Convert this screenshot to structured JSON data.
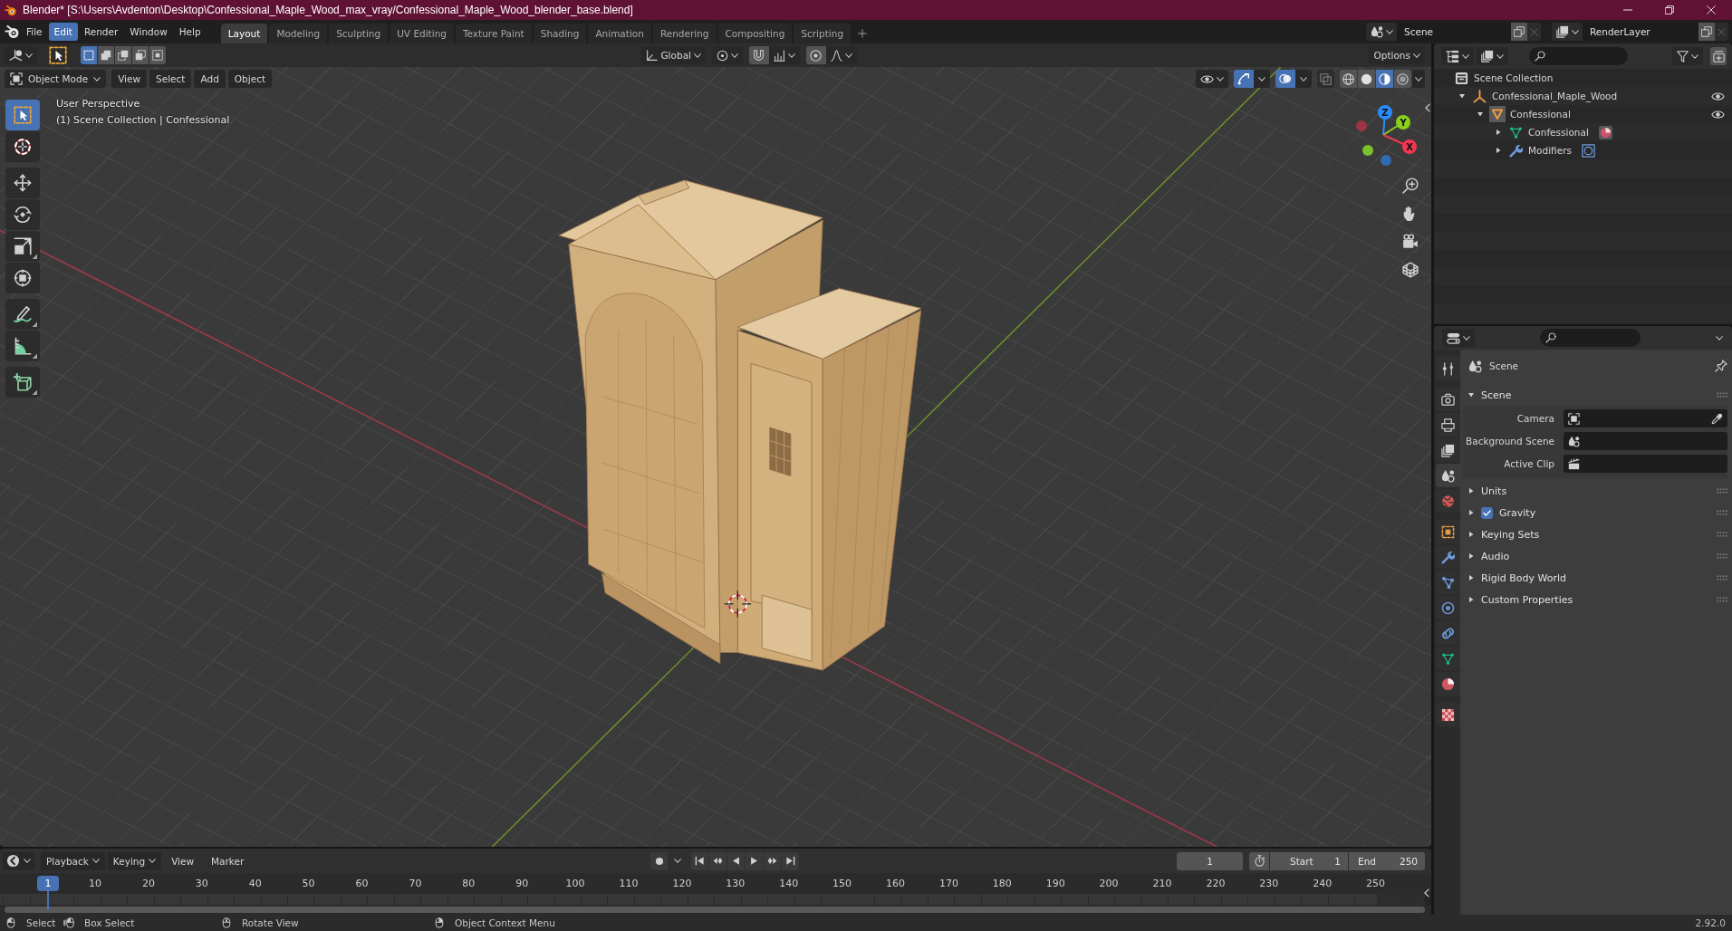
{
  "window": {
    "title": "Blender* [S:\\Users\\Avdenton\\Desktop\\Confessional_Maple_Wood_max_vray/Confessional_Maple_Wood_blender_base.blend]"
  },
  "menu": [
    {
      "label": "File",
      "selected": false
    },
    {
      "label": "Edit",
      "selected": true
    },
    {
      "label": "Render",
      "selected": false
    },
    {
      "label": "Window",
      "selected": false
    },
    {
      "label": "Help",
      "selected": false
    }
  ],
  "workspaces": [
    {
      "label": "Layout",
      "selected": true
    },
    {
      "label": "Modeling",
      "selected": false
    },
    {
      "label": "Sculpting",
      "selected": false
    },
    {
      "label": "UV Editing",
      "selected": false
    },
    {
      "label": "Texture Paint",
      "selected": false
    },
    {
      "label": "Shading",
      "selected": false
    },
    {
      "label": "Animation",
      "selected": false
    },
    {
      "label": "Rendering",
      "selected": false
    },
    {
      "label": "Compositing",
      "selected": false
    },
    {
      "label": "Scripting",
      "selected": false
    }
  ],
  "scene_selector": {
    "value": "Scene"
  },
  "view_layer_selector": {
    "value": "RenderLayer"
  },
  "viewport": {
    "tool_settings": {
      "select_modes": [
        {
          "kind": "set",
          "selected": true
        },
        {
          "kind": "extend",
          "selected": false
        },
        {
          "kind": "subtract",
          "selected": false
        },
        {
          "kind": "invert",
          "selected": false
        },
        {
          "kind": "intersect",
          "selected": false
        }
      ],
      "orientation": "Global",
      "options": "Options"
    },
    "header": {
      "mode": "Object Mode",
      "menus": [
        "View",
        "Select",
        "Add",
        "Object"
      ],
      "gizmos_on": true,
      "overlays_on": true,
      "xray_on": false,
      "shading_modes": [
        {
          "kind": "wireframe",
          "selected": false
        },
        {
          "kind": "solid",
          "selected": false
        },
        {
          "kind": "material",
          "selected": true
        },
        {
          "kind": "rendered",
          "selected": false
        }
      ]
    },
    "info": [
      "User Perspective",
      "(1) Scene Collection | Confessional"
    ],
    "tool_groups": [
      [
        {
          "kind": "select_box",
          "selected": true,
          "more": true
        },
        {
          "kind": "cursor",
          "selected": false,
          "more": false
        }
      ],
      [
        {
          "kind": "move",
          "selected": false,
          "more": false
        },
        {
          "kind": "rotate",
          "selected": false,
          "more": false
        },
        {
          "kind": "scale",
          "selected": false,
          "more": true
        },
        {
          "kind": "transform",
          "selected": false,
          "more": false
        }
      ],
      [
        {
          "kind": "annotate",
          "selected": false,
          "more": true
        },
        {
          "kind": "measure",
          "selected": false,
          "more": true
        }
      ],
      [
        {
          "kind": "add_cube",
          "selected": false,
          "more": true
        }
      ]
    ],
    "gizmo": {
      "x": "X",
      "y": "Y",
      "z": "Z"
    }
  },
  "outliner": {
    "tree": [
      {
        "label": "Scene Collection",
        "kind": "scene_collection",
        "children": [
          {
            "label": "Confessional_Maple_Wood",
            "kind": "empty",
            "expanded": true,
            "visible": true,
            "children": [
              {
                "label": "Confessional",
                "kind": "object",
                "active": true,
                "expanded": true,
                "visible": true,
                "children": [
                  {
                    "label": "Confessional",
                    "kind": "mesh",
                    "expanded": false,
                    "badge": {
                      "kind": "material"
                    }
                  },
                  {
                    "label": "Modifiers",
                    "kind": "modifiers",
                    "expanded": false,
                    "badge": {
                      "kind": "modifier"
                    }
                  }
                ]
              }
            ]
          }
        ]
      }
    ]
  },
  "properties": {
    "context": "Scene",
    "tab_groups": [
      [
        {
          "kind": "tool",
          "selected": false
        }
      ],
      [
        {
          "kind": "render",
          "selected": false
        },
        {
          "kind": "output",
          "selected": false
        },
        {
          "kind": "view_layer",
          "selected": false
        },
        {
          "kind": "scene",
          "selected": true
        },
        {
          "kind": "world",
          "selected": false
        }
      ],
      [
        {
          "kind": "object",
          "selected": false
        },
        {
          "kind": "modifiers",
          "selected": false
        },
        {
          "kind": "particles",
          "selected": false
        },
        {
          "kind": "physics",
          "selected": false
        },
        {
          "kind": "constraints",
          "selected": false
        },
        {
          "kind": "data",
          "selected": false
        },
        {
          "kind": "material",
          "selected": false
        }
      ],
      [
        {
          "kind": "texture",
          "selected": false
        }
      ]
    ],
    "panels": [
      {
        "title": "Scene",
        "kind": "plain",
        "expanded": true,
        "fields": [
          {
            "label": "Camera",
            "kind": "camera"
          },
          {
            "label": "Background Scene",
            "kind": "scene"
          },
          {
            "label": "Active Clip",
            "kind": "clip"
          }
        ]
      },
      {
        "title": "Units",
        "kind": "plain",
        "expanded": false
      },
      {
        "title": "Gravity",
        "kind": "checkbox",
        "checked": true,
        "expanded": false
      },
      {
        "title": "Keying Sets",
        "kind": "plain",
        "expanded": false
      },
      {
        "title": "Audio",
        "kind": "plain",
        "expanded": false
      },
      {
        "title": "Rigid Body World",
        "kind": "plain",
        "expanded": false
      },
      {
        "title": "Custom Properties",
        "kind": "plain",
        "expanded": false
      }
    ]
  },
  "timeline": {
    "menus": [
      {
        "label": "Playback",
        "kind": "dropdown"
      },
      {
        "label": "Keying",
        "kind": "dropdown"
      },
      {
        "label": "View",
        "kind": "menu"
      },
      {
        "label": "Marker",
        "kind": "menu"
      }
    ],
    "current_frame": "1",
    "start": {
      "label": "Start",
      "value": "1"
    },
    "end": {
      "label": "End",
      "value": "250"
    },
    "ruler": {
      "current": "1",
      "labels": [
        "10",
        "20",
        "30",
        "40",
        "50",
        "60",
        "70",
        "80",
        "90",
        "100",
        "110",
        "120",
        "130",
        "140",
        "150",
        "160",
        "170",
        "180",
        "190",
        "200",
        "210",
        "220",
        "230",
        "240",
        "250"
      ]
    }
  },
  "status_bar": {
    "hints": [
      {
        "kind": "left_click",
        "label": "Select"
      },
      {
        "kind": "left_drag",
        "label": "Box Select"
      },
      {
        "kind": "middle_drag",
        "label": "Rotate View"
      },
      {
        "kind": "right_click",
        "label": "Object Context Menu"
      }
    ],
    "version": "2.92.0"
  }
}
